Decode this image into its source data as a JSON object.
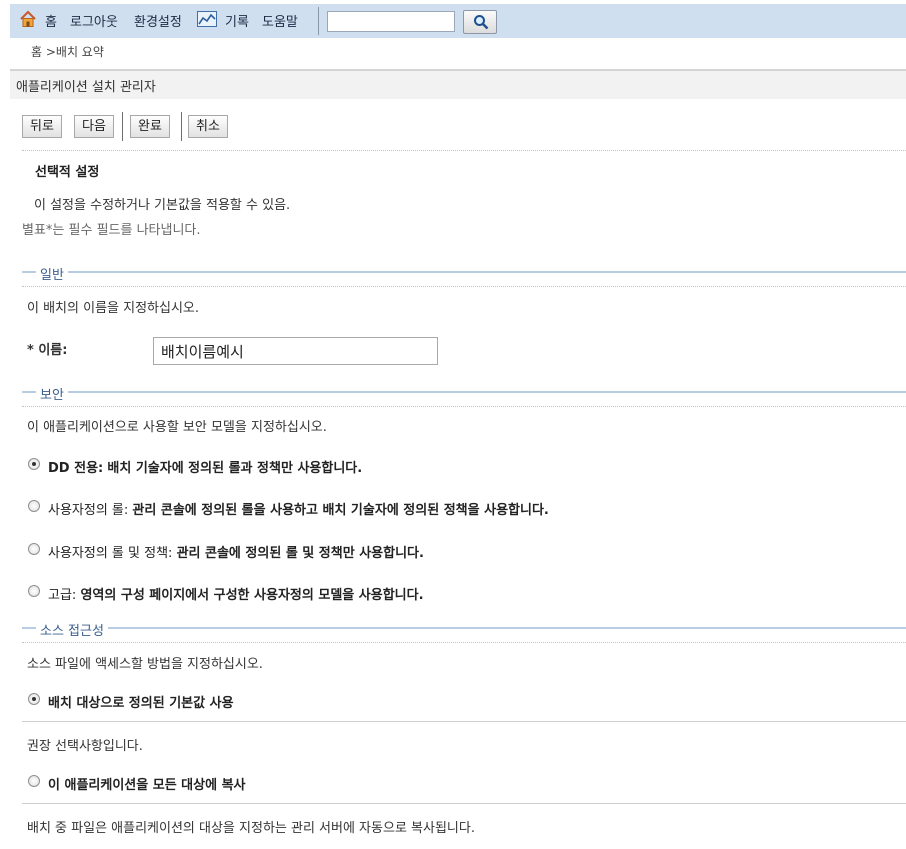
{
  "toolbar": {
    "home_label": "홈",
    "logout_label": "로그아웃",
    "preferences_label": "환경설정",
    "record_label": "기록",
    "help_label": "도움말",
    "search_value": ""
  },
  "breadcrumb": "홈 >배치 요약",
  "page_title": "애플리케이션 설치 관리자",
  "wizard_buttons": {
    "back": "뒤로",
    "next": "다음",
    "finish": "완료",
    "cancel": "취소"
  },
  "intro": {
    "heading": "선택적 설정",
    "description": "이 설정을 수정하거나 기본값을 적용할 수 있음.",
    "required_note": "별표*는 필수 필드를 나타냅니다."
  },
  "general": {
    "legend": "일반",
    "description": "이 배치의 이름을 지정하십시오.",
    "name_label": "* 이름:",
    "name_value": "배치이름예시"
  },
  "security": {
    "legend": "보안",
    "description": "이 애플리케이션으로 사용할 보안 모델을 지정하십시오.",
    "options": [
      {
        "title": "DD 전용:",
        "text": "배치 기술자에 정의된 롤과 정책만 사용합니다.",
        "checked": true
      },
      {
        "title": "사용자정의 롤:",
        "text": "관리 콘솔에 정의된 롤을 사용하고 배치 기술자에 정의된 정책을 사용합니다.",
        "checked": false
      },
      {
        "title": "사용자정의 롤 및 정책:",
        "text": "관리 콘솔에 정의된 롤 및 정책만 사용합니다.",
        "checked": false
      },
      {
        "title": "고급:",
        "text": "영역의 구성 페이지에서 구성한 사용자정의 모델을 사용합니다.",
        "checked": false
      }
    ]
  },
  "source_access": {
    "legend": "소스 접근성",
    "description": "소스 파일에 액세스할 방법을 지정하십시오.",
    "options": [
      {
        "label": "배치 대상으로 정의된 기본값 사용",
        "note": "권장 선택사항입니다.",
        "checked": true
      },
      {
        "label": "이 애플리케이션을 모든 대상에 복사",
        "note": "배치 중 파일은 애플리케이션의 대상을 지정하는 관리 서버에 자동으로 복사됩니다.",
        "checked": false
      }
    ]
  }
}
